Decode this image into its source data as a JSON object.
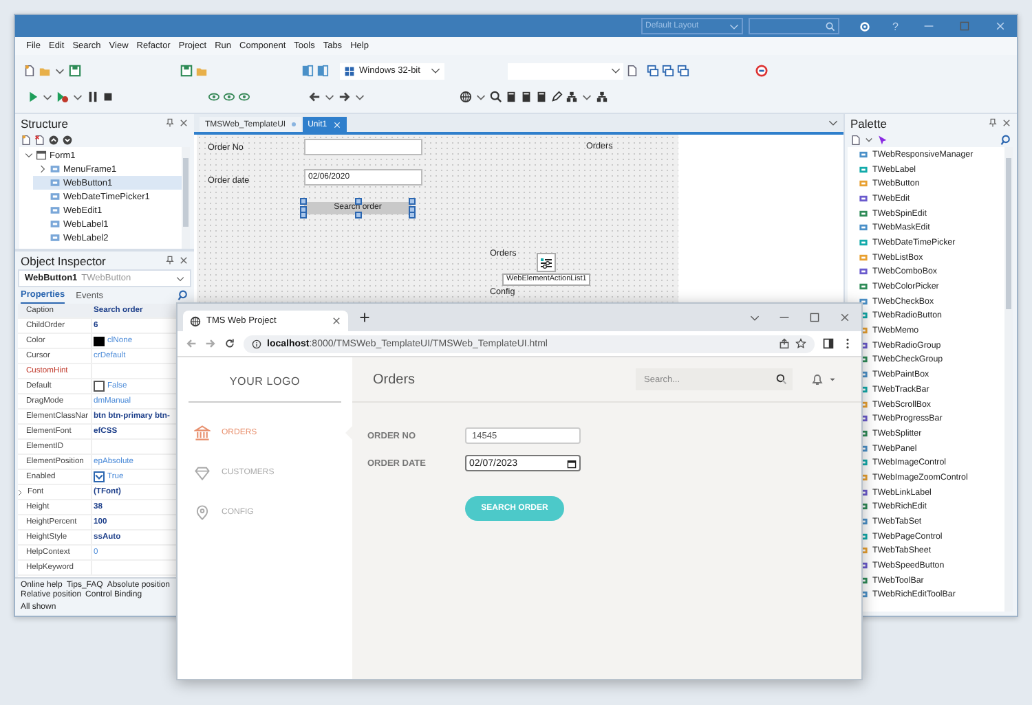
{
  "ide": {
    "title_bar": {
      "layout": "Default Layout",
      "help": "?"
    },
    "menu": [
      "File",
      "Edit",
      "Search",
      "View",
      "Refactor",
      "Project",
      "Run",
      "Component",
      "Tools",
      "Tabs",
      "Help"
    ],
    "toolbar": {
      "platform": "Windows 32-bit"
    },
    "structure": {
      "title": "Structure",
      "tree": [
        {
          "label": "Form1",
          "expanded": true,
          "selected": false,
          "children": [
            {
              "label": "MenuFrame1",
              "expanded": false,
              "selected": false
            },
            {
              "label": "WebButton1",
              "selected": true
            },
            {
              "label": "WebDateTimePicker1",
              "selected": false
            },
            {
              "label": "WebEdit1",
              "selected": false
            },
            {
              "label": "WebLabel1",
              "selected": false
            },
            {
              "label": "WebLabel2",
              "selected": false
            }
          ]
        }
      ]
    },
    "inspector": {
      "title": "Object Inspector",
      "object": "WebButton1",
      "class": "TWebButton",
      "tabs": [
        {
          "label": "Properties",
          "selected": true
        },
        {
          "label": "Events",
          "selected": false
        }
      ],
      "properties": [
        {
          "name": "Caption",
          "value": "Search order",
          "kind": "text",
          "modified": true,
          "selected": true
        },
        {
          "name": "ChildOrder",
          "value": "6",
          "kind": "text",
          "modified": true,
          "selected": false
        },
        {
          "name": "Color",
          "value": "clNone",
          "kind": "color",
          "color": "#000000",
          "modified": false,
          "selected": false
        },
        {
          "name": "Cursor",
          "value": "crDefault",
          "kind": "text",
          "modified": false,
          "selected": false
        },
        {
          "name": "CustomHint",
          "kind": "reference",
          "selected": false
        },
        {
          "name": "Default",
          "value": "False",
          "kind": "checkbox",
          "checked": false,
          "modified": false,
          "selected": false
        },
        {
          "name": "DragMode",
          "value": "dmManual",
          "kind": "text",
          "modified": false,
          "selected": false
        },
        {
          "name": "ElementClassNar",
          "value": "btn btn-primary btn-",
          "kind": "text",
          "modified": true,
          "selected": false
        },
        {
          "name": "ElementFont",
          "value": "efCSS",
          "kind": "text",
          "modified": true,
          "selected": false
        },
        {
          "name": "ElementID",
          "kind": "text",
          "selected": false
        },
        {
          "name": "ElementPosition",
          "value": "epAbsolute",
          "kind": "text",
          "modified": false,
          "selected": false
        },
        {
          "name": "Enabled",
          "value": "True",
          "kind": "checkbox",
          "checked": true,
          "modified": false,
          "selected": false
        },
        {
          "name": "Font",
          "value": "(TFont)",
          "kind": "expandable",
          "expanded": false,
          "modified": true,
          "selected": false
        },
        {
          "name": "Height",
          "value": "38",
          "kind": "text",
          "modified": true,
          "selected": false
        },
        {
          "name": "HeightPercent",
          "value": "100",
          "kind": "text",
          "modified": true,
          "selected": false
        },
        {
          "name": "HeightStyle",
          "value": "ssAuto",
          "kind": "text",
          "modified": true,
          "selected": false
        },
        {
          "name": "HelpContext",
          "value": "0",
          "kind": "text",
          "modified": false,
          "selected": false
        },
        {
          "name": "HelpKeyword",
          "kind": "text",
          "selected": false
        }
      ],
      "links": [
        "Online help",
        "Tips_FAQ",
        "Absolute position",
        "Relative position",
        "Control Binding"
      ],
      "filter": "All shown"
    },
    "editor_tabs": [
      {
        "label": "TMSWeb_TemplateUI",
        "selected": false,
        "modified": true
      },
      {
        "label": "Unit1",
        "selected": true,
        "modified": false
      }
    ],
    "designer": {
      "controls": [
        {
          "kind": "label",
          "text": "Order No"
        },
        {
          "kind": "edit"
        },
        {
          "kind": "label",
          "text": "Order date"
        },
        {
          "kind": "edit",
          "value": "02/06/2020"
        },
        {
          "kind": "button",
          "text": "Search order",
          "selected": true
        },
        {
          "kind": "label",
          "text": "Orders"
        },
        {
          "kind": "label",
          "text": "Orders"
        },
        {
          "kind": "component",
          "text": "WebElementActionList1"
        },
        {
          "kind": "label",
          "text": "Config"
        }
      ]
    },
    "palette": {
      "title": "Palette",
      "items": [
        "TWebResponsiveManager",
        "TWebLabel",
        "TWebButton",
        "TWebEdit",
        "TWebSpinEdit",
        "TWebMaskEdit",
        "TWebDateTimePicker",
        "TWebListBox",
        "TWebComboBox",
        "TWebColorPicker",
        "TWebCheckBox",
        "TWebRadioButton",
        "TWebMemo",
        "TWebRadioGroup",
        "TWebCheckGroup",
        "TWebPaintBox",
        "TWebTrackBar",
        "TWebScrollBox",
        "TWebProgressBar",
        "TWebSplitter",
        "TWebPanel",
        "TWebImageControl",
        "TWebImageZoomControl",
        "TWebLinkLabel",
        "TWebRichEdit",
        "TWebTabSet",
        "TWebPageControl",
        "TWebTabSheet",
        "TWebSpeedButton",
        "TWebToolBar",
        "TWebRichEditToolBar"
      ]
    }
  },
  "browser": {
    "tab": "TMS Web Project",
    "url": "**localhost**:8000/TMSWeb_TemplateUI/TMSWeb_TemplateUI.html",
    "app": {
      "logo": "YOUR LOGO",
      "nav": [
        {
          "label": "ORDERS",
          "selected": true
        },
        {
          "label": "CUSTOMERS",
          "selected": false
        },
        {
          "label": "CONFIG",
          "selected": false
        }
      ],
      "title": "Orders",
      "search": {
        "placeholder": "Search..."
      },
      "fields": [
        {
          "label": "ORDER NO",
          "value": "14545",
          "kind": "text"
        },
        {
          "label": "ORDER DATE",
          "value": "02/07/2023",
          "kind": "date"
        }
      ],
      "button": "SEARCH ORDER"
    }
  }
}
